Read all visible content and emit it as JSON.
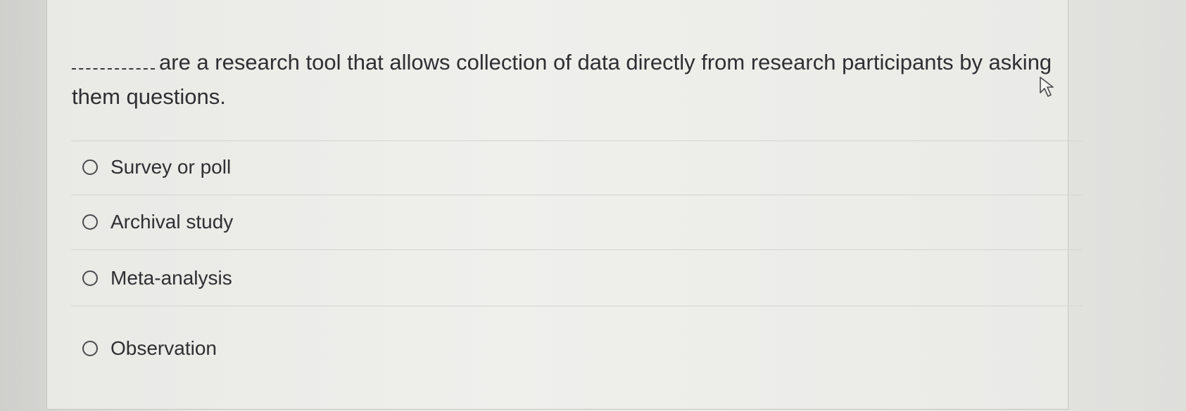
{
  "question": {
    "blank": "________",
    "text": "are a research tool that allows collection of data directly from research participants by asking them questions."
  },
  "options": [
    {
      "label": "Survey or poll"
    },
    {
      "label": "Archival study"
    },
    {
      "label": "Meta-analysis"
    },
    {
      "label": "Observation"
    }
  ],
  "cursor": {
    "icon": "mouse-pointer-icon"
  }
}
